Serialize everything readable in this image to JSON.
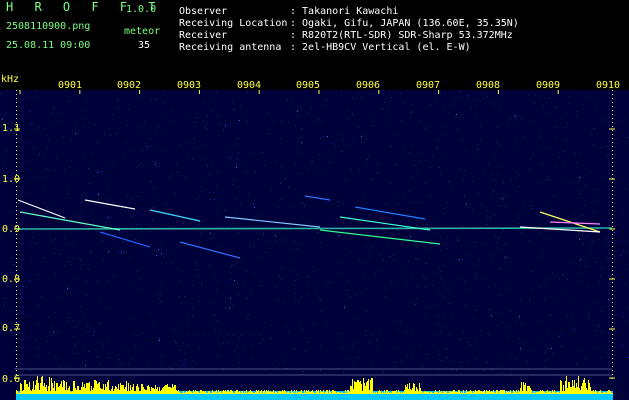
{
  "header": {
    "app_name": "H R O F F T",
    "version": "1.0.0",
    "filename": "2508110900.png",
    "datetime": "25.08.11 09:00",
    "meteor_label": "meteor",
    "meteor_count": "35",
    "info_keys": [
      "Observer",
      "Receiving Location",
      "Receiver",
      "Receiving antenna"
    ],
    "info_values": [
      ": Takanori Kawachi",
      ": Ogaki, Gifu, JAPAN (136.60E, 35.35N)",
      ": R820T2(RTL-SDR) SDR-Sharp 53.372MHz",
      ": 2el-HB9CV Vertical (el. E-W)"
    ]
  },
  "axis": {
    "unit": "kHz",
    "y_labels": [
      "1.1",
      "1.0",
      "0.9",
      "0.8",
      "0.7",
      "0.6"
    ],
    "x_labels": [
      "0901",
      "0902",
      "0903",
      "0904",
      "0905",
      "0906",
      "0907",
      "0908",
      "0909",
      "0910"
    ]
  },
  "colors": {
    "background": "#00003a",
    "label_yellow": "#ffff44",
    "header_green": "#7cff7c",
    "carrier": "#40ffd0",
    "histogram": "#ffff00",
    "histogram_base": "#00c8ff"
  }
}
